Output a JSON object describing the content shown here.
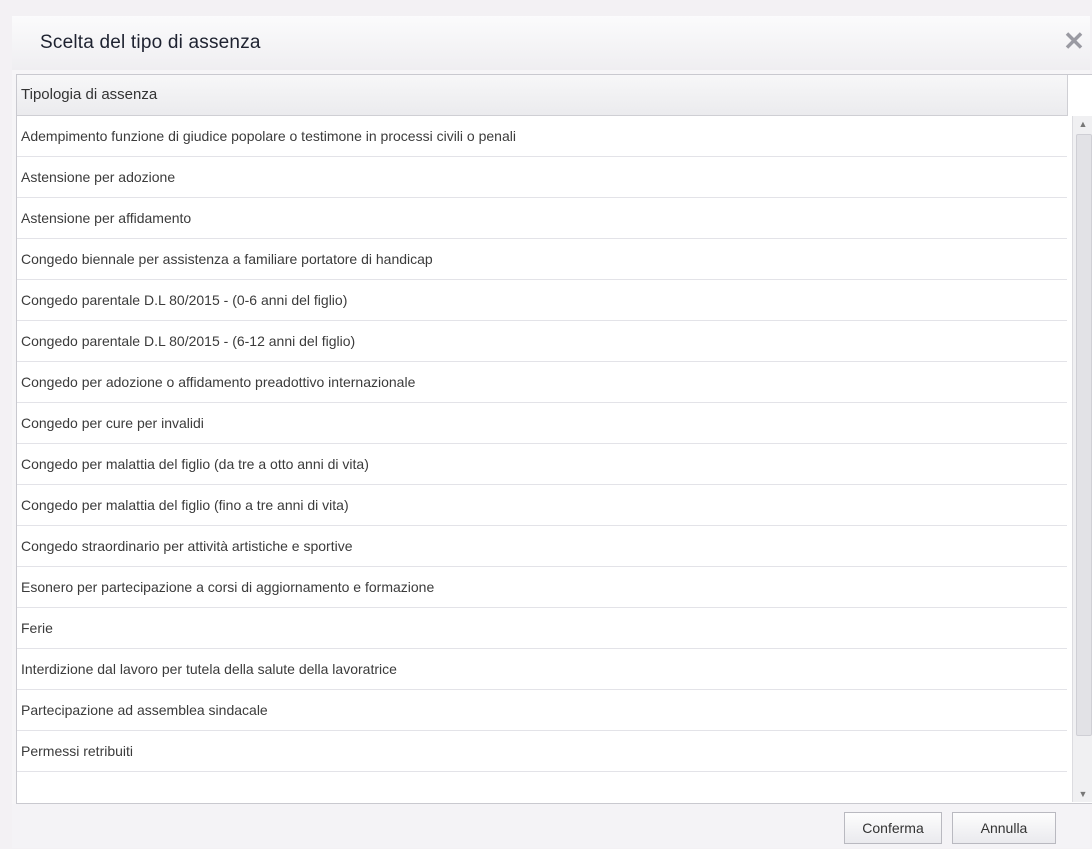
{
  "dialog": {
    "title": "Scelta del tipo di assenza",
    "close_icon": "close-icon"
  },
  "grid": {
    "column_header": "Tipologia di assenza",
    "rows": [
      "Adempimento funzione di giudice popolare o testimone in processi civili o penali",
      "Astensione per adozione",
      "Astensione per affidamento",
      "Congedo biennale per assistenza a familiare portatore di handicap",
      "Congedo parentale D.L 80/2015 - (0-6 anni del figlio)",
      "Congedo parentale D.L 80/2015 - (6-12 anni del figlio)",
      "Congedo per adozione o affidamento preadottivo internazionale",
      "Congedo per cure per invalidi",
      "Congedo per malattia del figlio (da tre a otto anni di vita)",
      "Congedo per malattia del figlio (fino a tre anni di vita)",
      "Congedo straordinario per attività artistiche e sportive",
      "Esonero per partecipazione a corsi di aggiornamento e formazione",
      "Ferie",
      "Interdizione dal lavoro per tutela della salute della lavoratrice",
      "Partecipazione ad assemblea sindacale",
      "Permessi retribuiti"
    ]
  },
  "footer": {
    "confirm_label": "Conferma",
    "cancel_label": "Annulla"
  }
}
